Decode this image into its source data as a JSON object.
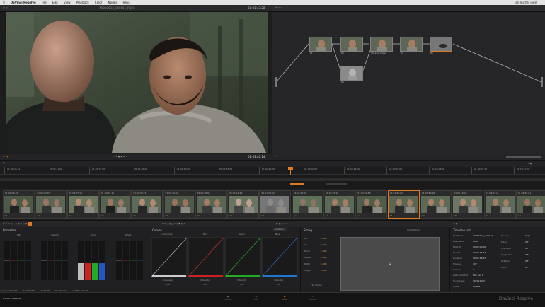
{
  "menu_bar": {
    "app": "DaVinci Resolve",
    "items": [
      "File",
      "Edit",
      "View",
      "Playback",
      "Color",
      "Nodes",
      "Help"
    ],
    "right": "jon michel joest"
  },
  "viewer": {
    "clip_name": "A001C012_140101_R1CS",
    "timecode": "00:03:43:20",
    "playhead_tc": "01:03:40:14"
  },
  "node_graph": {
    "title": "Nodes",
    "nodes": [
      {
        "id": "01",
        "label": ""
      },
      {
        "id": "02",
        "label": ""
      },
      {
        "id": "03",
        "label": "Layer Mixer"
      },
      {
        "id": "04",
        "label": ""
      },
      {
        "id": "05",
        "label": ""
      },
      {
        "id": "06",
        "label": ""
      }
    ]
  },
  "ruler": {
    "ticks": [
      "01:00:06:12",
      "01:00:12:00",
      "01:00:37:00",
      "01:01:04:00",
      "01:01:30:00",
      "01:01:55:00",
      "01:02:22:00",
      "01:03:00:00",
      "01:03:14:00",
      "01:03:40:00",
      "01:04:06:00",
      "01:04:31:00",
      "01:04:57:00"
    ]
  },
  "clips": [
    {
      "tc": "01:00:06:16",
      "n": "01"
    },
    {
      "tc": "01:00:12:03",
      "n": "02"
    },
    {
      "tc": "01:00:27:16",
      "n": "03"
    },
    {
      "tc": "01:00:32:10",
      "n": "04"
    },
    {
      "tc": "01:00:38:21",
      "n": "05"
    },
    {
      "tc": "01:00:46:00",
      "n": "06"
    },
    {
      "tc": "01:00:58:07",
      "n": "07"
    },
    {
      "tc": "01:01:14:12",
      "n": "08"
    },
    {
      "tc": "01:01:39:00",
      "n": "09"
    },
    {
      "tc": "01:02:21:06",
      "n": "10"
    },
    {
      "tc": "01:02:48:18",
      "n": "11"
    },
    {
      "tc": "01:03:01:15",
      "n": "12"
    },
    {
      "tc": "01:03:40:02",
      "n": "13"
    },
    {
      "tc": "01:03:59:18",
      "n": "14"
    },
    {
      "tc": "01:04:18:03",
      "n": "15"
    },
    {
      "tc": "01:04:44:11",
      "n": "16"
    },
    {
      "tc": "01:04:55:01",
      "n": "17"
    }
  ],
  "primaries": {
    "title": "Primaries",
    "wheels": [
      "Lift",
      "Gamma",
      "Gain",
      "Offset"
    ],
    "footer": [
      "Contrast 1.000",
      "Pivot 0.435",
      "Sat 50.00",
      "Hue 50.00",
      "Lum Mix 100.00"
    ]
  },
  "curves": {
    "title": "Curves",
    "mode": "Custom",
    "channels": [
      "Luminance",
      "Red",
      "Green",
      "Blue"
    ],
    "intensity_label": "Intensity",
    "intensity_value": "1.0"
  },
  "sizing": {
    "title": "Sizing",
    "mode": "Input Sizing",
    "params": [
      {
        "k": "Pan",
        "v": "0.000"
      },
      {
        "k": "Tilt",
        "v": "0.000"
      },
      {
        "k": "Zoom",
        "v": "1.000"
      },
      {
        "k": "Rotate",
        "v": "0.000"
      },
      {
        "k": "Width",
        "v": "1.000"
      },
      {
        "k": "Height",
        "v": "1.000"
      }
    ],
    "footer": "Flip Image"
  },
  "timeline_info": {
    "title": "Timeline Info",
    "rows": [
      {
        "k": "File Name",
        "v": "A001C012_140101"
      },
      {
        "k": "Reel Name",
        "v": "A001"
      },
      {
        "k": "Start TC",
        "v": "00:00:00:00"
      },
      {
        "k": "End TC",
        "v": "00:00:16:23"
      },
      {
        "k": "Duration",
        "v": "00:00:16:23"
      },
      {
        "k": "Frames",
        "v": "407"
      },
      {
        "k": "Version",
        "v": "1"
      },
      {
        "k": "Date Modified",
        "v": "Mon Jan 1"
      },
      {
        "k": "Source Res",
        "v": "1920x1080"
      },
      {
        "k": "Codec",
        "v": "ProRes"
      }
    ],
    "right_rows": [
      {
        "k": "Display",
        "v": "Clips"
      },
      {
        "k": "Flags",
        "v": "Off"
      },
      {
        "k": "Clip Color",
        "v": "Off"
      },
      {
        "k": "Keyframes",
        "v": "Off"
      },
      {
        "k": "Gradient",
        "v": "Off"
      },
      {
        "k": "Audio",
        "v": "On"
      }
    ]
  },
  "status": {
    "project": "DAVINCI SESSION",
    "tabs": [
      "Media",
      "Edit",
      "Color",
      "Deliver"
    ],
    "active_tab": "Color",
    "brand": "DaVinci Resolve"
  }
}
